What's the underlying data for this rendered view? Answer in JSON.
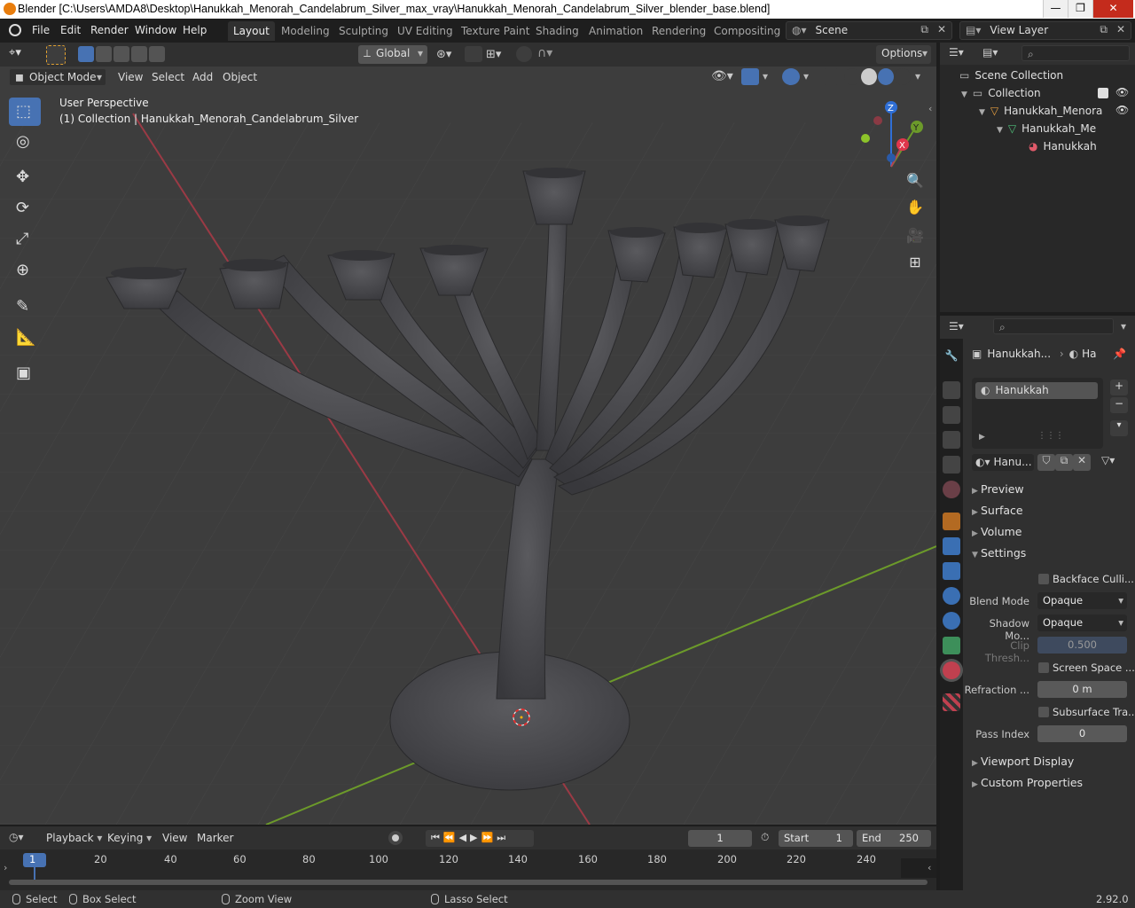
{
  "window": {
    "title": "Blender [C:\\Users\\AMDA8\\Desktop\\Hanukkah_Menorah_Candelabrum_Silver_max_vray\\Hanukkah_Menorah_Candelabrum_Silver_blender_base.blend]",
    "minimize": "—",
    "maximize": "❐",
    "close": "✕"
  },
  "menu": {
    "file": "File",
    "edit": "Edit",
    "render": "Render",
    "window": "Window",
    "help": "Help"
  },
  "workspaces": [
    "Layout",
    "Modeling",
    "Sculpting",
    "UV Editing",
    "Texture Paint",
    "Shading",
    "Animation",
    "Rendering",
    "Compositing"
  ],
  "scene": {
    "label": "Scene",
    "view_layer": "View Layer"
  },
  "viewport_header": {
    "transform_orientation": "Global",
    "options": "Options",
    "mode": "Object Mode",
    "view": "View",
    "select": "Select",
    "add": "Add",
    "object": "Object"
  },
  "viewport": {
    "perspective": "User Perspective",
    "collection_info": "(1) Collection | Hanukkah_Menorah_Candelabrum_Silver",
    "gizmo": {
      "x": "X",
      "y": "Y",
      "z": "Z"
    }
  },
  "outliner": {
    "scene_collection": "Scene Collection",
    "collection": "Collection",
    "object": "Hanukkah_Menora",
    "mesh": "Hanukkah_Me",
    "material": "Hanukkah"
  },
  "properties": {
    "breadcrumb_object": "Hanukkah...",
    "breadcrumb_material": "Ha",
    "slot_name": "Hanukkah",
    "material_name": "Hanu...",
    "panels": {
      "preview": "Preview",
      "surface": "Surface",
      "volume": "Volume",
      "settings": "Settings",
      "viewport_display": "Viewport Display",
      "custom_properties": "Custom Properties"
    },
    "settings": {
      "backface_culling": "Backface Culli...",
      "blend_mode_label": "Blend Mode",
      "blend_mode_value": "Opaque",
      "shadow_mode_label": "Shadow Mo...",
      "shadow_mode_value": "Opaque",
      "clip_threshold_label": "Clip Thresh...",
      "clip_threshold_value": "0.500",
      "screen_space": "Screen Space ...",
      "refraction_label": "Refraction ...",
      "refraction_value": "0 m",
      "subsurface": "Subsurface Tra...",
      "pass_index_label": "Pass Index",
      "pass_index_value": "0"
    }
  },
  "timeline": {
    "playback": "Playback",
    "keying": "Keying",
    "view": "View",
    "marker": "Marker",
    "current_frame": "1",
    "start_label": "Start",
    "start_value": "1",
    "end_label": "End",
    "end_value": "250",
    "ticks": [
      "1",
      "20",
      "40",
      "60",
      "80",
      "100",
      "120",
      "140",
      "160",
      "180",
      "200",
      "220",
      "240"
    ]
  },
  "statusbar": {
    "select": "Select",
    "box_select": "Box Select",
    "zoom_view": "Zoom View",
    "lasso_select": "Lasso Select",
    "version": "2.92.0"
  },
  "colors": {
    "accent": "#4772b3",
    "viewport_bg": "#3d3d3d",
    "x_axis": "#b34350",
    "y_axis": "#6c9a2a",
    "z_axis": "#2f6fd6"
  }
}
